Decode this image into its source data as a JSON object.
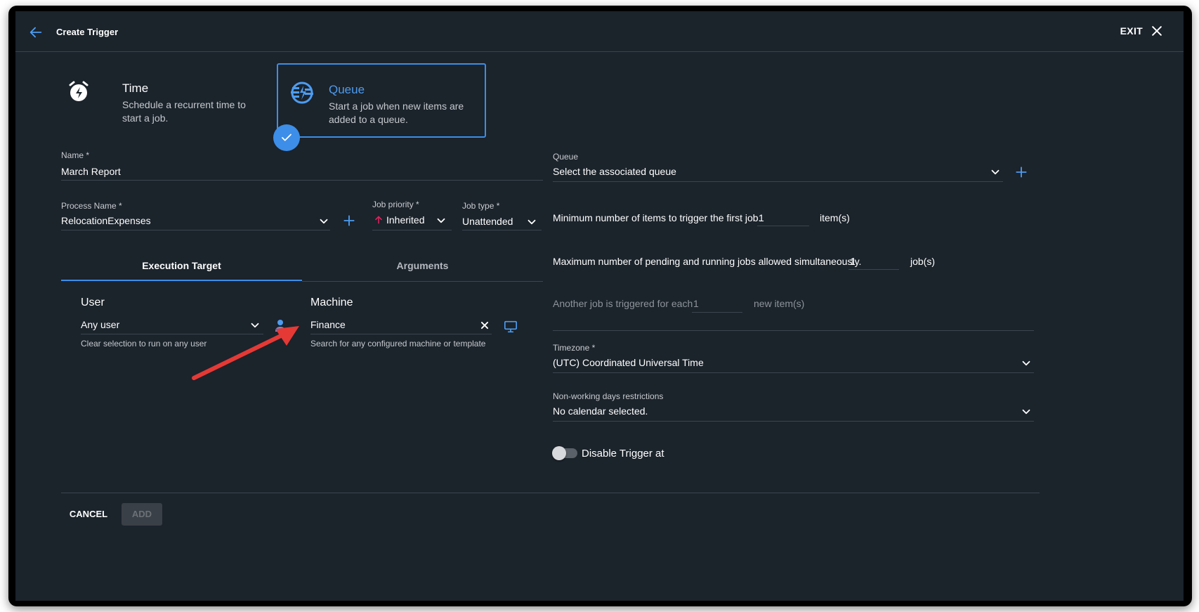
{
  "header": {
    "title": "Create Trigger",
    "exit_label": "EXIT"
  },
  "trigger_types": {
    "time": {
      "title": "Time",
      "desc": "Schedule a recurrent time to start a job."
    },
    "queue": {
      "title": "Queue",
      "desc": "Start a job when new items are added to a queue.",
      "selected": true
    }
  },
  "form": {
    "name_label": "Name *",
    "name_value": "March Report",
    "process_label": "Process Name *",
    "process_value": "RelocationExpenses",
    "priority_label": "Job priority *",
    "priority_value": "Inherited",
    "jobtype_label": "Job type *",
    "jobtype_value": "Unattended"
  },
  "tabs": {
    "execution": "Execution Target",
    "arguments": "Arguments"
  },
  "execution": {
    "user_heading": "User",
    "user_value": "Any user",
    "user_helper": "Clear selection to run on any user",
    "machine_heading": "Machine",
    "machine_value": "Finance",
    "machine_helper": "Search for any configured machine or template"
  },
  "queue": {
    "queue_label": "Queue",
    "queue_placeholder": "Select the associated queue",
    "min_label": "Minimum number of items to trigger the first job.",
    "min_value": "1",
    "min_unit": "item(s)",
    "max_label": "Maximum number of pending and running jobs allowed simultaneously.",
    "max_value": "1",
    "max_unit": "job(s)",
    "another_label": "Another job is triggered for each",
    "another_value": "1",
    "another_unit": "new item(s)",
    "timezone_label": "Timezone *",
    "timezone_value": "(UTC) Coordinated Universal Time",
    "nonworking_label": "Non-working days restrictions",
    "nonworking_value": "No calendar selected.",
    "disable_label": "Disable Trigger at"
  },
  "footer": {
    "cancel": "CANCEL",
    "add": "ADD"
  },
  "colors": {
    "accent": "#3c8ee8",
    "background": "#1b232b",
    "annotation_arrow": "#e53935",
    "priority_arrow": "#e0245e"
  }
}
